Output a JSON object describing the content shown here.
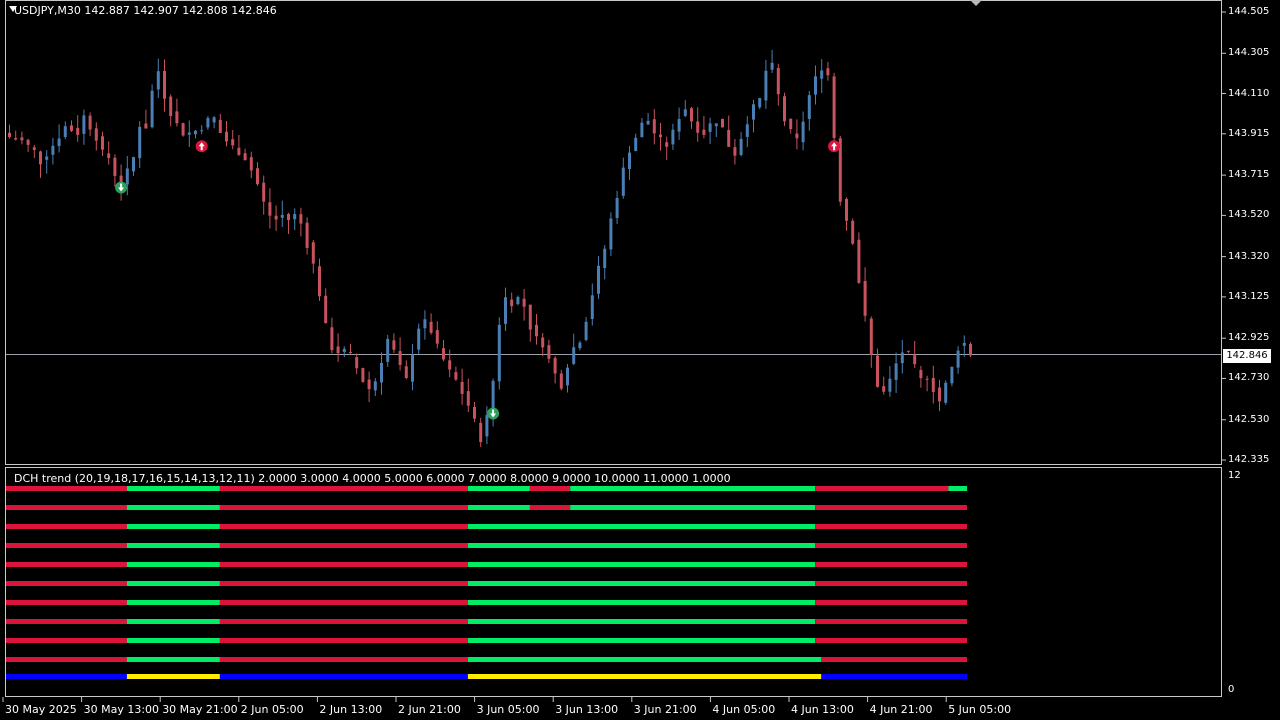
{
  "header": {
    "symbol_info": "USDJPY,M30  142.887 142.907 142.808 142.846"
  },
  "indicator": {
    "title": "DCH trend (20,19,18,17,16,15,14,13,12,11) 2.0000 3.0000 4.0000 5.0000 6.0000 7.0000 8.0000 9.0000 10.0000 11.0000 1.0000",
    "scale_top": "12",
    "scale_bottom": "0"
  },
  "bid_price": "142.846",
  "colors": {
    "bull_candle": "#4a7fb5",
    "bear_candle": "#c8535e",
    "up_trend": "#00ee66",
    "down_trend": "#dc143c",
    "signal_yellow": "#ffee00",
    "signal_blue": "#0000ff",
    "buy_arrow": "#2e9e5b",
    "sell_arrow": "#dc143c"
  },
  "chart_data": {
    "type": "candlestick",
    "y_axis_ticks": [
      "144.505",
      "144.305",
      "144.110",
      "143.915",
      "143.715",
      "143.520",
      "143.320",
      "143.125",
      "142.925",
      "142.730",
      "142.530",
      "142.335"
    ],
    "ylim": [
      142.335,
      144.505
    ],
    "x_axis_ticks": [
      "30 May 2025",
      "30 May 13:00",
      "30 May 21:00",
      "2 Jun 05:00",
      "2 Jun 13:00",
      "2 Jun 21:00",
      "3 Jun 05:00",
      "3 Jun 13:00",
      "3 Jun 21:00",
      "4 Jun 05:00",
      "4 Jun 13:00",
      "4 Jun 21:00",
      "5 Jun 05:00"
    ],
    "current_price": 142.846,
    "close_path": [
      [
        0,
        143.9
      ],
      [
        2,
        143.88
      ],
      [
        4,
        143.83
      ],
      [
        5,
        143.78
      ],
      [
        7,
        143.86
      ],
      [
        9,
        143.95
      ],
      [
        11,
        143.92
      ],
      [
        12,
        144.0
      ],
      [
        14,
        143.9
      ],
      [
        15,
        143.82
      ],
      [
        16,
        143.8
      ],
      [
        17,
        143.72
      ],
      [
        18,
        143.66
      ],
      [
        20,
        143.8
      ],
      [
        21,
        143.96
      ],
      [
        22,
        143.95
      ],
      [
        23,
        144.12
      ],
      [
        24,
        144.22
      ],
      [
        25,
        144.1
      ],
      [
        26,
        144.02
      ],
      [
        27,
        143.96
      ],
      [
        28,
        143.92
      ],
      [
        29,
        143.92
      ],
      [
        30,
        143.93
      ],
      [
        31,
        143.95
      ],
      [
        32,
        143.98
      ],
      [
        33,
        143.99
      ],
      [
        34,
        143.92
      ],
      [
        35,
        143.88
      ],
      [
        36,
        143.85
      ],
      [
        37,
        143.83
      ],
      [
        38,
        143.8
      ],
      [
        39,
        143.74
      ],
      [
        40,
        143.67
      ],
      [
        41,
        143.58
      ],
      [
        42,
        143.52
      ],
      [
        43,
        143.5
      ],
      [
        44,
        143.52
      ],
      [
        45,
        143.5
      ],
      [
        46,
        143.52
      ],
      [
        47,
        143.48
      ],
      [
        48,
        143.38
      ],
      [
        49,
        143.28
      ],
      [
        50,
        143.14
      ],
      [
        51,
        142.98
      ],
      [
        52,
        142.88
      ],
      [
        53,
        142.86
      ],
      [
        54,
        142.86
      ],
      [
        55,
        142.84
      ],
      [
        56,
        142.78
      ],
      [
        57,
        142.72
      ],
      [
        58,
        142.68
      ],
      [
        59,
        142.72
      ],
      [
        60,
        142.82
      ],
      [
        61,
        142.92
      ],
      [
        62,
        142.86
      ],
      [
        63,
        142.78
      ],
      [
        64,
        142.72
      ],
      [
        65,
        142.86
      ],
      [
        66,
        142.98
      ],
      [
        67,
        143.0
      ],
      [
        68,
        142.96
      ],
      [
        69,
        142.88
      ],
      [
        70,
        142.82
      ],
      [
        71,
        142.76
      ],
      [
        72,
        142.72
      ],
      [
        73,
        142.66
      ],
      [
        74,
        142.6
      ],
      [
        75,
        142.52
      ],
      [
        76,
        142.44
      ],
      [
        77,
        142.54
      ],
      [
        78,
        142.72
      ],
      [
        79,
        143.0
      ],
      [
        80,
        143.12
      ],
      [
        81,
        143.1
      ],
      [
        82,
        143.12
      ],
      [
        83,
        143.08
      ],
      [
        84,
        142.98
      ],
      [
        85,
        142.92
      ],
      [
        86,
        142.9
      ],
      [
        87,
        142.82
      ],
      [
        88,
        142.75
      ],
      [
        89,
        142.7
      ],
      [
        90,
        142.8
      ],
      [
        91,
        142.88
      ],
      [
        92,
        142.92
      ],
      [
        93,
        143.02
      ],
      [
        94,
        143.14
      ],
      [
        95,
        143.26
      ],
      [
        96,
        143.36
      ],
      [
        97,
        143.5
      ],
      [
        98,
        143.62
      ],
      [
        99,
        143.74
      ],
      [
        100,
        143.84
      ],
      [
        101,
        143.9
      ],
      [
        102,
        143.96
      ],
      [
        103,
        143.98
      ],
      [
        104,
        143.92
      ],
      [
        105,
        143.88
      ],
      [
        106,
        143.86
      ],
      [
        107,
        143.92
      ],
      [
        108,
        144.0
      ],
      [
        109,
        144.04
      ],
      [
        110,
        143.98
      ],
      [
        111,
        143.94
      ],
      [
        112,
        143.92
      ],
      [
        113,
        143.96
      ],
      [
        114,
        143.98
      ],
      [
        115,
        143.94
      ],
      [
        116,
        143.86
      ],
      [
        117,
        143.82
      ],
      [
        118,
        143.9
      ],
      [
        119,
        143.98
      ],
      [
        120,
        144.04
      ],
      [
        121,
        144.08
      ],
      [
        122,
        144.22
      ],
      [
        123,
        144.24
      ],
      [
        124,
        144.1
      ],
      [
        125,
        143.98
      ],
      [
        126,
        143.92
      ],
      [
        127,
        143.88
      ],
      [
        128,
        143.98
      ],
      [
        129,
        144.1
      ],
      [
        130,
        144.18
      ],
      [
        131,
        144.24
      ],
      [
        132,
        144.2
      ],
      [
        133,
        143.9
      ],
      [
        134,
        143.6
      ],
      [
        135,
        143.5
      ],
      [
        136,
        143.4
      ],
      [
        137,
        143.2
      ],
      [
        138,
        143.02
      ],
      [
        139,
        142.84
      ],
      [
        140,
        142.7
      ],
      [
        141,
        142.66
      ],
      [
        142,
        142.72
      ],
      [
        143,
        142.8
      ],
      [
        144,
        142.86
      ],
      [
        145,
        142.84
      ],
      [
        146,
        142.78
      ],
      [
        147,
        142.72
      ],
      [
        148,
        142.74
      ],
      [
        149,
        142.68
      ],
      [
        150,
        142.62
      ],
      [
        151,
        142.7
      ],
      [
        152,
        142.78
      ],
      [
        153,
        142.88
      ],
      [
        154,
        142.9
      ],
      [
        155,
        142.85
      ]
    ],
    "signals": [
      {
        "type": "buy",
        "bar": 18,
        "price": 143.655
      },
      {
        "type": "sell",
        "bar": 31,
        "price": 143.855
      },
      {
        "type": "buy",
        "bar": 78,
        "price": 142.56
      },
      {
        "type": "sell",
        "bar": 133,
        "price": 143.855
      }
    ],
    "indicator_rows": [
      {
        "segments": [
          [
            "down",
            0,
            19.5
          ],
          [
            "up",
            19.5,
            34.5
          ],
          [
            "down",
            34.5,
            74.5
          ],
          [
            "up",
            74.5,
            84.5
          ],
          [
            "down",
            84.5,
            91
          ],
          [
            "up",
            91,
            130.5
          ],
          [
            "down",
            130.5,
            152
          ],
          [
            "up",
            152,
            155
          ]
        ]
      },
      {
        "segments": [
          [
            "down",
            0,
            19.5
          ],
          [
            "up",
            19.5,
            34.5
          ],
          [
            "down",
            34.5,
            74.5
          ],
          [
            "up",
            74.5,
            84.5
          ],
          [
            "down",
            84.5,
            91
          ],
          [
            "up",
            91,
            130.5
          ],
          [
            "down",
            130.5,
            155
          ]
        ]
      },
      {
        "segments": [
          [
            "down",
            0,
            19.5
          ],
          [
            "up",
            19.5,
            34.5
          ],
          [
            "down",
            34.5,
            74.5
          ],
          [
            "up",
            74.5,
            130.5
          ],
          [
            "down",
            130.5,
            155
          ]
        ]
      },
      {
        "segments": [
          [
            "down",
            0,
            19.5
          ],
          [
            "up",
            19.5,
            34.5
          ],
          [
            "down",
            34.5,
            74.5
          ],
          [
            "up",
            74.5,
            130.5
          ],
          [
            "down",
            130.5,
            155
          ]
        ]
      },
      {
        "segments": [
          [
            "down",
            0,
            19.5
          ],
          [
            "up",
            19.5,
            34.5
          ],
          [
            "down",
            34.5,
            74.5
          ],
          [
            "up",
            74.5,
            130.5
          ],
          [
            "down",
            130.5,
            155
          ]
        ]
      },
      {
        "segments": [
          [
            "down",
            0,
            19.5
          ],
          [
            "up",
            19.5,
            34.5
          ],
          [
            "down",
            34.5,
            74.5
          ],
          [
            "up",
            74.5,
            130.5
          ],
          [
            "down",
            130.5,
            155
          ]
        ]
      },
      {
        "segments": [
          [
            "down",
            0,
            19.5
          ],
          [
            "up",
            19.5,
            34.5
          ],
          [
            "down",
            34.5,
            74.5
          ],
          [
            "up",
            74.5,
            130.5
          ],
          [
            "down",
            130.5,
            155
          ]
        ]
      },
      {
        "segments": [
          [
            "down",
            0,
            19.5
          ],
          [
            "up",
            19.5,
            34.5
          ],
          [
            "down",
            34.5,
            74.5
          ],
          [
            "up",
            74.5,
            130.5
          ],
          [
            "down",
            130.5,
            155
          ]
        ]
      },
      {
        "segments": [
          [
            "down",
            0,
            19.5
          ],
          [
            "up",
            19.5,
            34.5
          ],
          [
            "down",
            34.5,
            74.5
          ],
          [
            "up",
            74.5,
            130.5
          ],
          [
            "down",
            130.5,
            155
          ]
        ]
      },
      {
        "segments": [
          [
            "down",
            0,
            19.5
          ],
          [
            "up",
            19.5,
            34.5
          ],
          [
            "down",
            34.5,
            74.5
          ],
          [
            "up",
            74.5,
            131.5
          ],
          [
            "down",
            131.5,
            155
          ]
        ]
      },
      {
        "segments": [
          [
            "blue",
            0,
            19.5
          ],
          [
            "yellow",
            19.5,
            34.5
          ],
          [
            "blue",
            34.5,
            74.5
          ],
          [
            "yellow",
            74.5,
            131.5
          ],
          [
            "blue",
            131.5,
            155
          ]
        ]
      }
    ]
  }
}
